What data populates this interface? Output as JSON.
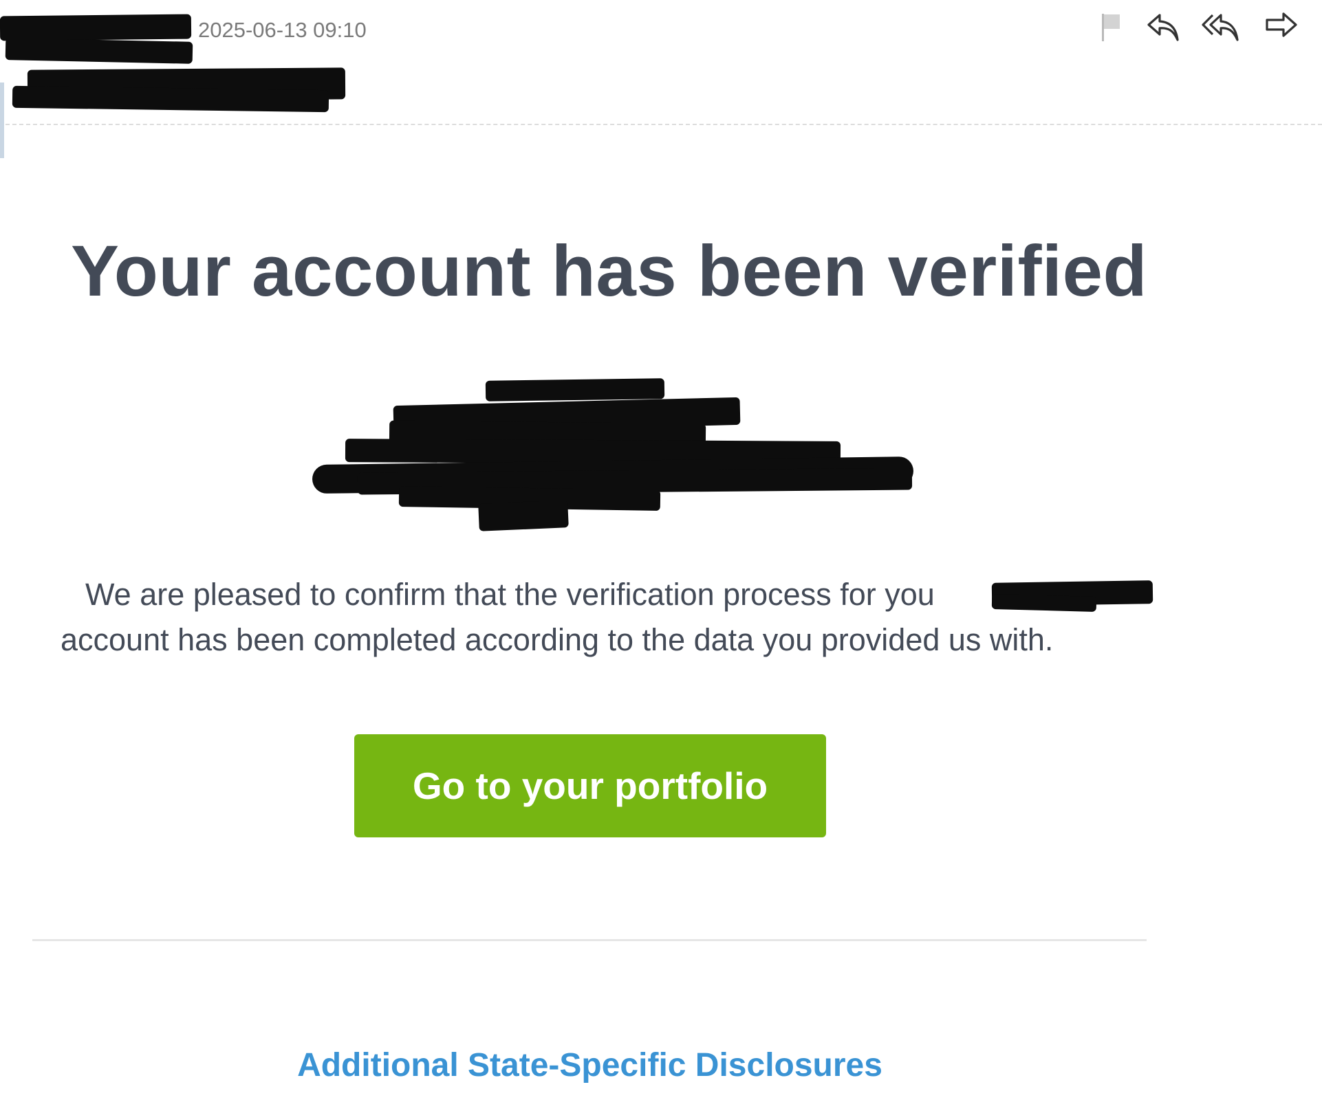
{
  "message": {
    "timestamp": "2025-06-13 09:10",
    "redacted_sender": "",
    "redacted_recipient": ""
  },
  "toolbar": {
    "flag_icon": "flag-icon",
    "reply_icon": "reply-icon",
    "reply_all_icon": "reply-all-icon",
    "forward_icon": "forward-icon"
  },
  "email": {
    "headline": "Your account has been verified",
    "body_line1": "We are pleased to confirm that the verification process for you",
    "body_line2": "account has been completed according to the data you provided us with.",
    "cta_label": "Go to your portfolio",
    "disclosures_link": "Additional State-Specific Disclosures"
  },
  "colors": {
    "headline": "#434a57",
    "cta_background": "#76b612",
    "link": "#3a93d4",
    "timestamp": "#7a7a7a"
  }
}
